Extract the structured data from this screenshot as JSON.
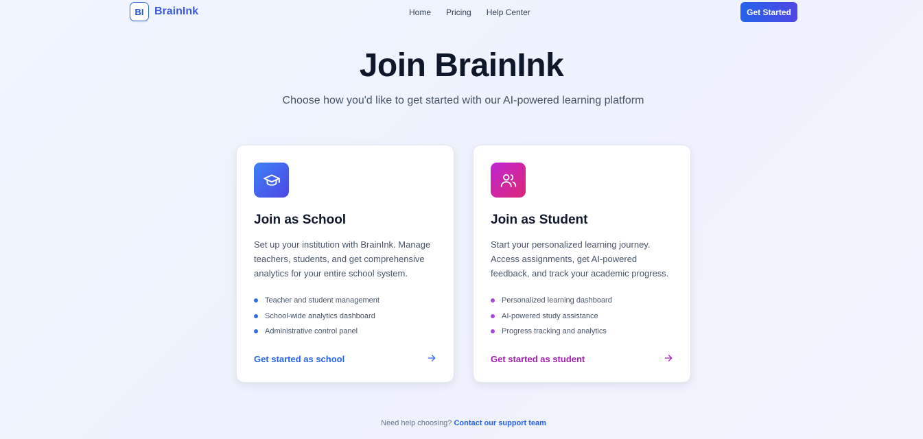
{
  "header": {
    "logo_mark": "BI",
    "brand": "BrainInk",
    "links": [
      "Home",
      "Pricing",
      "Help Center"
    ],
    "cta": "Get Started"
  },
  "hero": {
    "title": "Join BrainInk",
    "subtitle": "Choose how you'd like to get started with our AI-powered learning platform"
  },
  "cards": [
    {
      "icon": "graduation-cap-icon",
      "title": "Join as School",
      "description": "Set up your institution with BrainInk. Manage teachers, students, and get comprehensive analytics for your entire school system.",
      "features": [
        "Teacher and student management",
        "School-wide analytics dashboard",
        "Administrative control panel"
      ],
      "link": "Get started as school",
      "accent": "#2563eb"
    },
    {
      "icon": "users-icon",
      "title": "Join as Student",
      "description": "Start your personalized learning journey. Access assignments, get AI-powered feedback, and track your academic progress.",
      "features": [
        "Personalized learning dashboard",
        "AI-powered study assistance",
        "Progress tracking and analytics"
      ],
      "link": "Get started as student",
      "accent": "#a21caf"
    }
  ],
  "footer": {
    "text": "Need help choosing?",
    "link": "Contact our support team"
  }
}
